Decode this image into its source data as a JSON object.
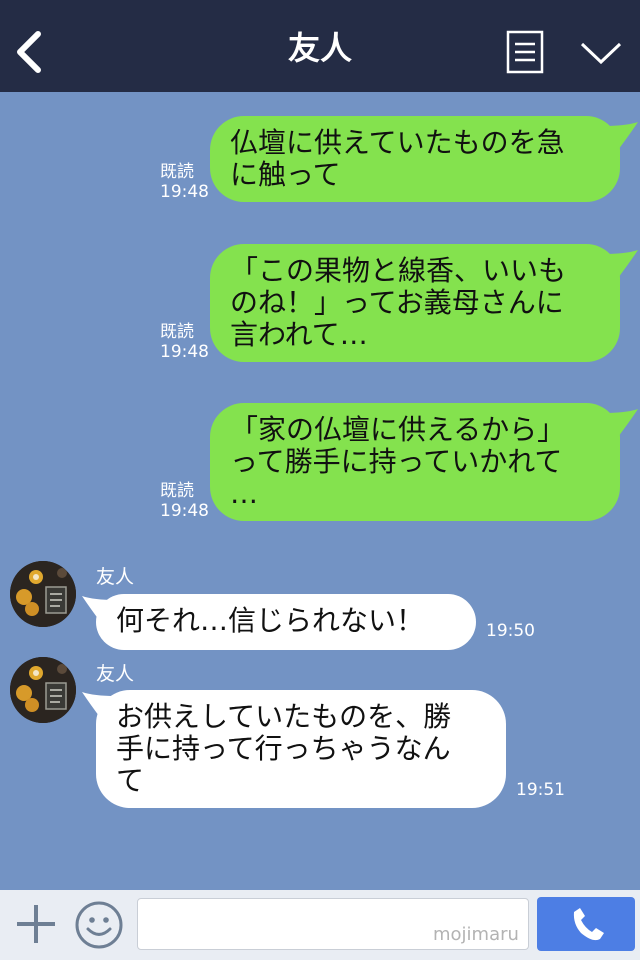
{
  "header": {
    "title": "友人",
    "back_icon": "chevron-left-icon",
    "menu_icon": "menu-list-icon",
    "collapse_icon": "chevron-down-icon"
  },
  "messages": [
    {
      "direction": "out",
      "lines": [
        "仏壇に供えていたものを急",
        "に触って"
      ],
      "read_label": "既読",
      "time": "19:48"
    },
    {
      "direction": "out",
      "lines": [
        "「この果物と線香、いいも",
        "のね！」ってお義母さんに",
        "言われて…"
      ],
      "read_label": "既読",
      "time": "19:48"
    },
    {
      "direction": "out",
      "lines": [
        "「家の仏壇に供えるから」",
        "って勝手に持っていかれて",
        "…"
      ],
      "read_label": "既読",
      "time": "19:48"
    },
    {
      "direction": "in",
      "sender": "友人",
      "lines": [
        "何それ…信じられない！"
      ],
      "time": "19:50"
    },
    {
      "direction": "in",
      "sender": "友人",
      "lines": [
        "お供えしていたものを、勝",
        "手に持って行っちゃうなん",
        "て"
      ],
      "time": "19:51"
    }
  ],
  "input_bar": {
    "plus_icon": "plus-icon",
    "emoji_icon": "smiley-icon",
    "watermark": "mojimaru",
    "call_icon": "phone-icon"
  },
  "colors": {
    "header_bg": "#242c45",
    "chat_bg": "#7393c4",
    "outgoing_bubble": "#84e24e",
    "incoming_bubble": "#ffffff",
    "call_button": "#4d7ee4"
  }
}
